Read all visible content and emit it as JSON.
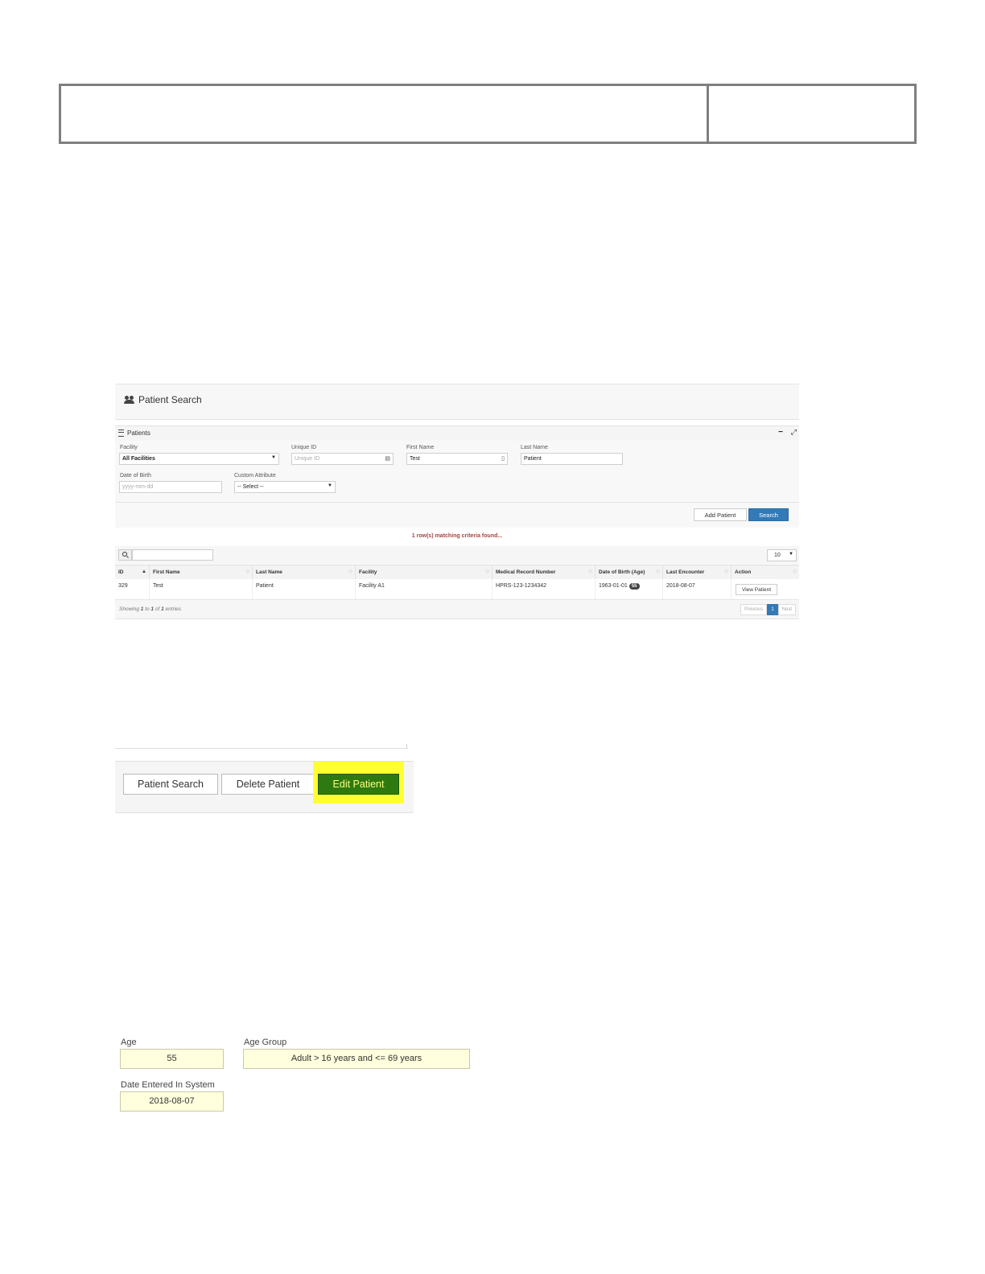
{
  "patient_search": {
    "title": "Patient Search",
    "panel_label": "Patients",
    "panel_minimize": "−",
    "panel_expand": "⤢",
    "filters": {
      "facility_label": "Facility",
      "facility_value": "All Facilities",
      "unique_id_label": "Unique ID",
      "unique_id_placeholder": "Unique ID",
      "first_name_label": "First Name",
      "first_name_value": "Test",
      "last_name_label": "Last Name",
      "last_name_value": "Patient",
      "dob_label": "Date of Birth",
      "dob_placeholder": "yyyy-mm-dd",
      "custom_attr_label": "Custom Attribute",
      "custom_attr_value": "-- Select --"
    },
    "add_patient_label": "Add Patient",
    "search_label": "Search",
    "match_text": "1 row(s) matching criteria found...",
    "page_size": "10",
    "columns": [
      "ID",
      "First Name",
      "Last Name",
      "Facility",
      "Medical Record Number",
      "Date of Birth (Age)",
      "Last Encounter",
      "Action"
    ],
    "row": {
      "id": "329",
      "first_name": "Test",
      "last_name": "Patient",
      "facility": "Facility A1",
      "mrn": "HPRS-123-1234342",
      "dob": "1963-01-01",
      "age": "55",
      "last_encounter": "2018-08-07",
      "action": "View Patient"
    },
    "showing_prefix": "Showing",
    "showing_from": "1",
    "showing_to_word": "to",
    "showing_to": "1",
    "showing_of_word": "of",
    "showing_total": "1",
    "showing_suffix": "entries",
    "pager": {
      "previous": "Previous",
      "page": "1",
      "next": "Next"
    }
  },
  "button_bar": {
    "patient_search": "Patient Search",
    "delete_patient": "Delete Patient",
    "edit_patient": "Edit Patient"
  },
  "age_fields": {
    "age_label": "Age",
    "age_value": "55",
    "age_group_label": "Age Group",
    "age_group_value": "Adult > 16 years and <= 69 years",
    "date_entered_label": "Date Entered In System",
    "date_entered_value": "2018-08-07"
  },
  "colors": {
    "primary_blue": "#337ab7",
    "highlight_yellow": "#ffff33",
    "edit_green": "#2f7a10",
    "match_text_red": "#a94442",
    "readonly_field": "#ffffdd"
  }
}
